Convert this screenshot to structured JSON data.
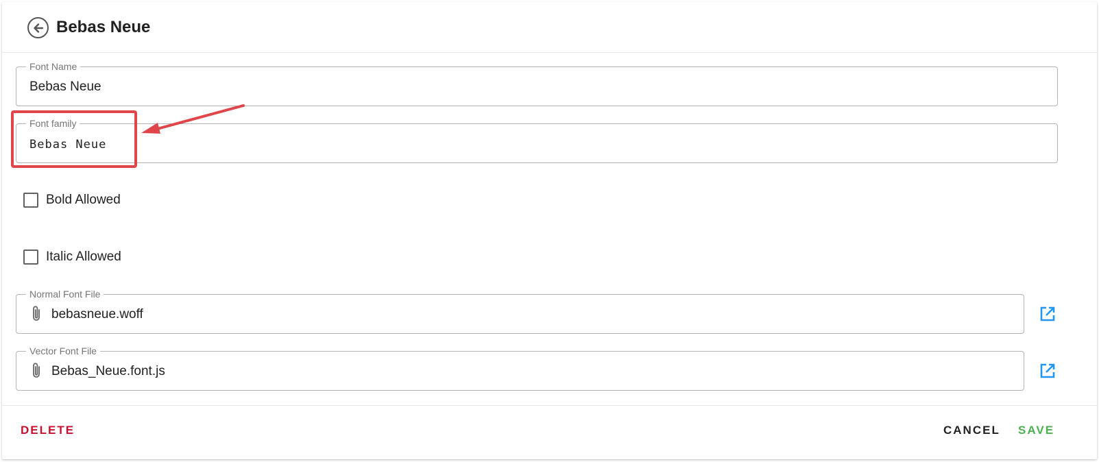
{
  "header": {
    "title": "Bebas Neue"
  },
  "fields": {
    "font_name": {
      "label": "Font Name",
      "value": "Bebas Neue"
    },
    "font_family": {
      "label": "Font family",
      "value": "Bebas Neue"
    },
    "normal_font_file": {
      "label": "Normal Font File",
      "value": "bebasneue.woff"
    },
    "vector_font_file": {
      "label": "Vector Font File",
      "value": "Bebas_Neue.font.js"
    }
  },
  "checkboxes": {
    "bold": {
      "label": "Bold Allowed",
      "checked": false
    },
    "italic": {
      "label": "Italic Allowed",
      "checked": false
    }
  },
  "footer": {
    "delete_label": "DELETE",
    "cancel_label": "CANCEL",
    "save_label": "SAVE"
  },
  "icons": {
    "back": "arrow-left-circle-icon",
    "attach": "paperclip-icon",
    "open": "open-in-new-icon"
  },
  "colors": {
    "delete": "#c8102e",
    "save": "#4caf50",
    "link": "#2196f3",
    "annotation": "#e0454a"
  }
}
